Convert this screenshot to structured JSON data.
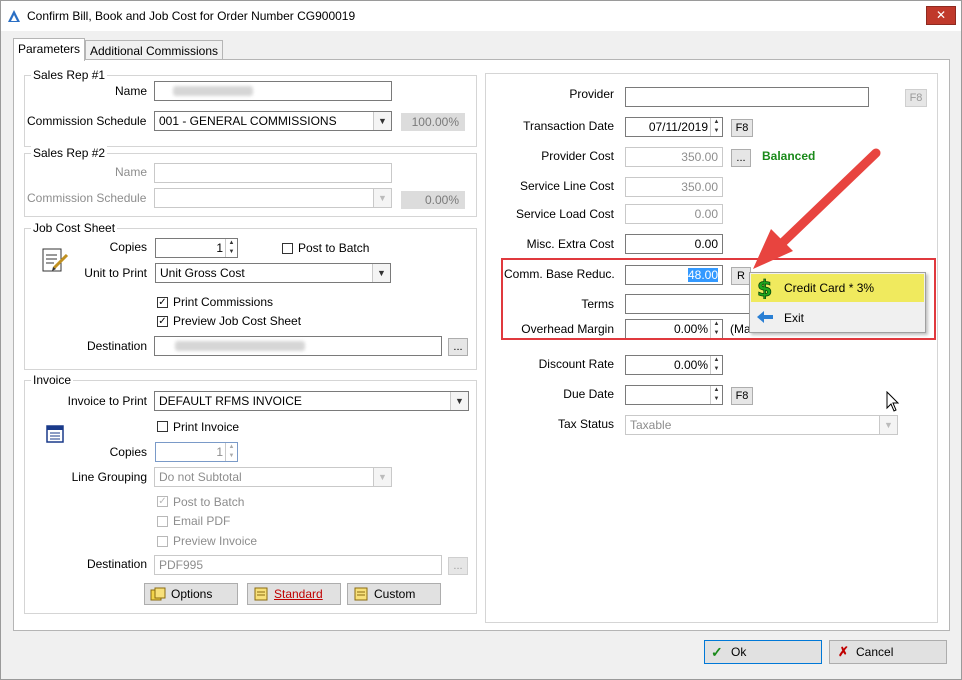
{
  "window": {
    "title": "Confirm Bill, Book and Job Cost for Order Number CG900019",
    "close": "✕"
  },
  "tabs": [
    {
      "label": "Parameters"
    },
    {
      "label": "Additional Commissions"
    }
  ],
  "sales_rep1": {
    "title": "Sales Rep #1",
    "name_label": "Name",
    "schedule_label": "Commission Schedule",
    "schedule_value": "001 - GENERAL COMMISSIONS",
    "percent": "100.00%"
  },
  "sales_rep2": {
    "title": "Sales Rep #2",
    "name_label": "Name",
    "schedule_label": "Commission Schedule",
    "percent": "0.00%"
  },
  "job_cost": {
    "title": "Job Cost Sheet",
    "copies_label": "Copies",
    "copies_value": "1",
    "post_to_batch": "Post to Batch",
    "unit_label": "Unit to Print",
    "unit_value": "Unit Gross Cost",
    "print_commissions": "Print Commissions",
    "preview": "Preview Job Cost Sheet",
    "destination_label": "Destination",
    "browse": "..."
  },
  "invoice": {
    "title": "Invoice",
    "to_print_label": "Invoice to Print",
    "to_print_value": "DEFAULT RFMS INVOICE",
    "print_invoice": "Print Invoice",
    "copies_label": "Copies",
    "copies_value": "1",
    "line_grouping_label": "Line Grouping",
    "line_grouping_value": "Do not Subtotal",
    "post_to_batch": "Post to Batch",
    "email_pdf": "Email PDF",
    "preview_invoice": "Preview Invoice",
    "destination_label": "Destination",
    "destination_value": "PDF995",
    "browse": "...",
    "options": "Options",
    "standard": "Standard",
    "custom": "Custom"
  },
  "right": {
    "provider_label": "Provider",
    "f8": "F8",
    "transaction_date_label": "Transaction Date",
    "transaction_date_value": "07/11/2019",
    "provider_cost_label": "Provider Cost",
    "provider_cost_value": "350.00",
    "browse": "...",
    "balanced": "Balanced",
    "service_line_cost_label": "Service Line Cost",
    "service_line_cost_value": "350.00",
    "service_load_cost_label": "Service Load Cost",
    "service_load_cost_value": "0.00",
    "misc_extra_cost_label": "Misc. Extra Cost",
    "misc_extra_cost_value": "0.00",
    "comm_base_label": "Comm. Base Reduc.",
    "comm_base_value": "48.00",
    "r_button": "R",
    "terms_label": "Terms",
    "overhead_label": "Overhead Margin",
    "overhead_value": "0.00%",
    "overhead_suffix": "(Ma",
    "discount_rate_label": "Discount Rate",
    "discount_rate_value": "0.00%",
    "due_date_label": "Due Date",
    "tax_status_label": "Tax Status",
    "tax_status_value": "Taxable"
  },
  "popup_menu": [
    {
      "label": "Credit Card * 3%"
    },
    {
      "label": "Exit"
    }
  ],
  "footer": {
    "ok": "Ok",
    "cancel": "Cancel"
  },
  "colors": {
    "highlight_box": "#e0393e",
    "arrow": "#e8443f",
    "menu_highlight": "#f0ea5e",
    "balanced": "#1a8a1a",
    "selection": "#3399ff"
  }
}
